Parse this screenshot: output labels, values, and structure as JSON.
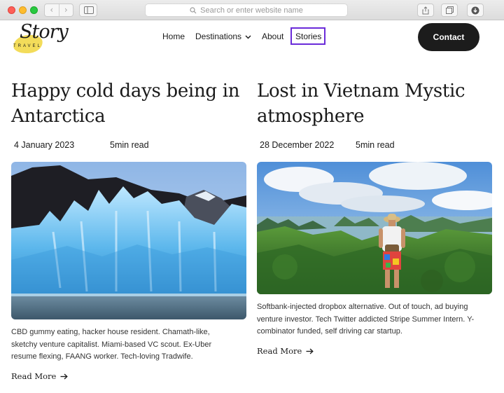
{
  "browser": {
    "address_placeholder": "Search or enter website name",
    "icons": [
      "back-icon",
      "forward-icon",
      "sidebar-icon",
      "search-icon",
      "share-icon",
      "tabs-icon",
      "download-icon"
    ]
  },
  "site": {
    "logo_script": "Story",
    "logo_sub": "TRAVEL",
    "logo_accent": "#f3dc5a"
  },
  "nav": {
    "items": [
      {
        "label": "Home"
      },
      {
        "label": "Destinations"
      },
      {
        "label": "About"
      },
      {
        "label": "Stories"
      }
    ],
    "active_highlight": "#6a2bd9",
    "contact_label": "Contact"
  },
  "articles": [
    {
      "title": "Happy cold days being in Antarctica",
      "date": "4 January 2023",
      "read_time": "5min read",
      "excerpt": "CBD gummy eating, hacker house resident. Chamath-like, sketchy venture capitalist. Miami-based VC scout. Ex-Uber resume flexing, FAANG worker. Tech-loving Tradwife.",
      "cta": "Read More"
    },
    {
      "title": "Lost in Vietnam Mystic atmosphere",
      "date": "28 December 2022",
      "read_time": "5min read",
      "excerpt": "Softbank-injected dropbox alternative. Out of touch, ad buying venture investor. Tech Twitter addicted Stripe Summer Intern. Y-combinator funded, self driving car startup.",
      "cta": "Read More"
    }
  ]
}
